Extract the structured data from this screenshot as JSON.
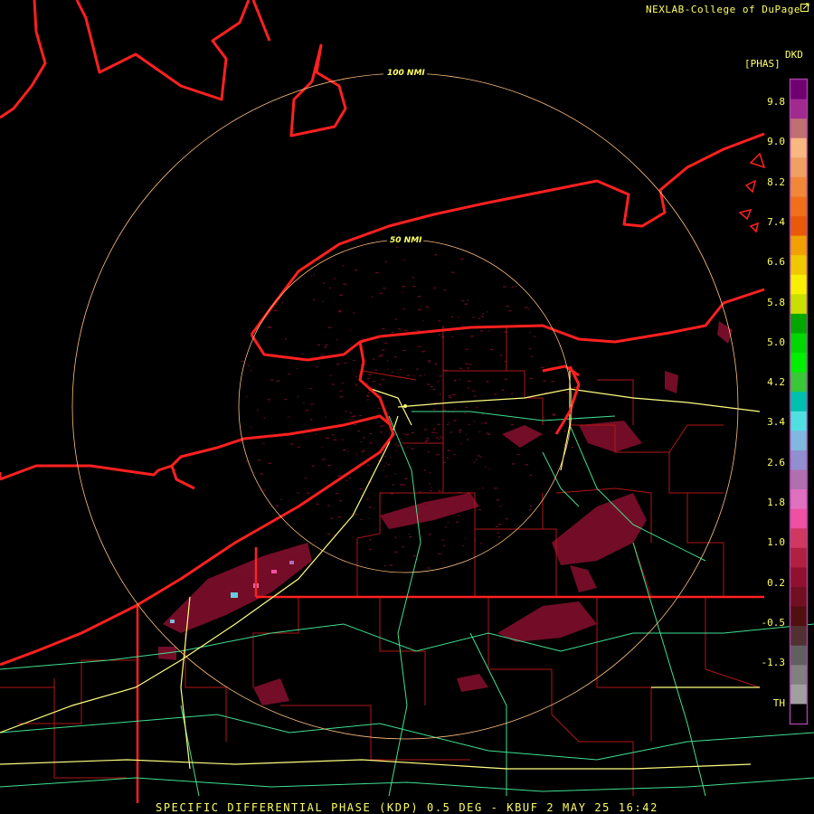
{
  "header": {
    "credit": "NEXLAB-College of DuPage"
  },
  "legend": {
    "unit_code": "DKD",
    "unit_label": "[PHAS]",
    "ticks": [
      "9.8",
      "9.0",
      "8.2",
      "7.4",
      "6.6",
      "5.8",
      "5.0",
      "4.2",
      "3.4",
      "2.6",
      "1.8",
      "1.0",
      "0.2",
      "-0.5",
      "-1.3",
      "TH"
    ],
    "colors": [
      "#700070",
      "#a02a90",
      "#c07070",
      "#f8b880",
      "#f0a060",
      "#f08838",
      "#f07018",
      "#e85a0a",
      "#f0a000",
      "#f0c800",
      "#f8f000",
      "#c8e000",
      "#00a800",
      "#00d800",
      "#00f000",
      "#38c838",
      "#00c0b0",
      "#50e0e0",
      "#80b8e0",
      "#9090d0",
      "#b070b0",
      "#e070c0",
      "#f050a0",
      "#d03860",
      "#b02040",
      "#901030",
      "#701020",
      "#501010",
      "#503030",
      "#606060",
      "#808080",
      "#a0a0a0",
      "#000000"
    ]
  },
  "range_rings": [
    {
      "label": "100 NMI"
    },
    {
      "label": "50 NMI"
    }
  ],
  "footer": {
    "caption": "SPECIFIC DIFFERENTIAL PHASE (KDP) 0.5 DEG - KBUF 2 MAY 25 16:42"
  },
  "colors": {
    "coastline": "#ff2020",
    "boundary": "#c01818",
    "interstate": "#ffff80",
    "highway": "#40e090",
    "ring": "#ffc080",
    "text": "#ffff66"
  }
}
